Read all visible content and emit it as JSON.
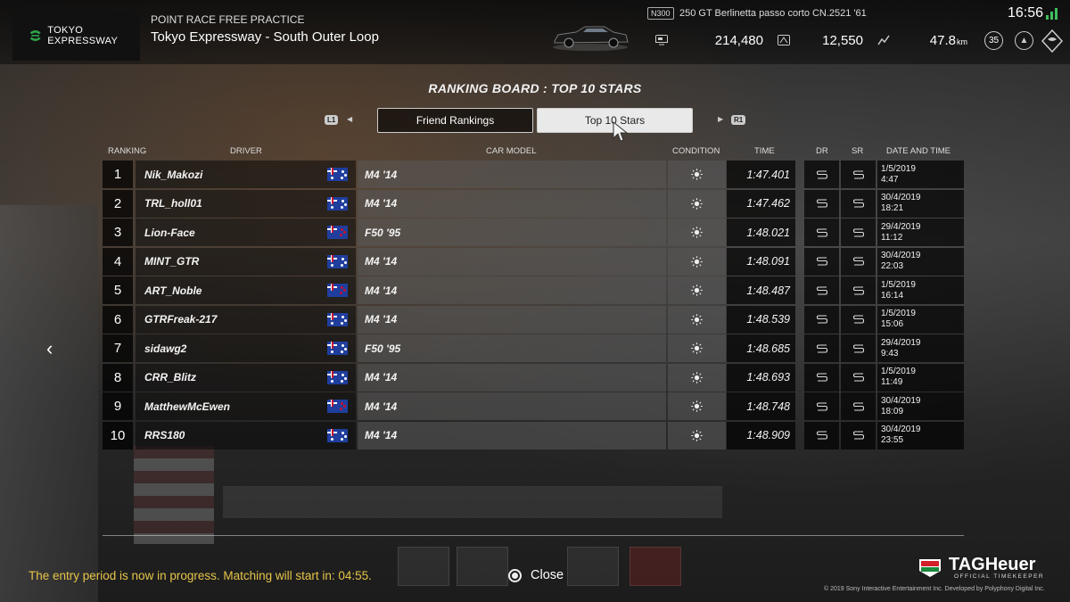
{
  "header": {
    "track_logo_text": "TOKYO EXPRESSWAY",
    "event_type": "POINT RACE FREE PRACTICE",
    "track_name": "Tokyo Expressway - South Outer Loop",
    "car_badge": "N300",
    "car_name": "250 GT Berlinetta passo corto CN.2521 '61",
    "credits": "214,480",
    "mileage_points": "12,550",
    "distance": "47.8",
    "distance_unit": "km",
    "clock": "16:56",
    "level": "35"
  },
  "board": {
    "title": "RANKING BOARD : TOP 10 STARS",
    "bumper_left": "L1",
    "bumper_right": "R1",
    "tabs": [
      {
        "label": "Friend Rankings",
        "active": false
      },
      {
        "label": "Top 10 Stars",
        "active": true
      }
    ],
    "columns": {
      "ranking": "RANKING",
      "driver": "DRIVER",
      "car_model": "CAR MODEL",
      "condition": "CONDITION",
      "time": "TIME",
      "dr": "DR",
      "sr": "SR",
      "date_time": "DATE AND TIME"
    },
    "rows": [
      {
        "rank": "1",
        "driver": "Nik_Makozi",
        "car": "M4 '14",
        "time": "1:47.401",
        "dr": "S",
        "sr": "S",
        "date": "1/5/2019",
        "clock": "4:47",
        "flag": "AU"
      },
      {
        "rank": "2",
        "driver": "TRL_holl01",
        "car": "M4 '14",
        "time": "1:47.462",
        "dr": "S",
        "sr": "S",
        "date": "30/4/2019",
        "clock": "18:21",
        "flag": "AU"
      },
      {
        "rank": "3",
        "driver": "Lion-Face",
        "car": "F50 '95",
        "time": "1:48.021",
        "dr": "S",
        "sr": "S",
        "date": "29/4/2019",
        "clock": "11:12",
        "flag": "NZ"
      },
      {
        "rank": "4",
        "driver": "MINT_GTR",
        "car": "M4 '14",
        "time": "1:48.091",
        "dr": "S",
        "sr": "S",
        "date": "30/4/2019",
        "clock": "22:03",
        "flag": "AU"
      },
      {
        "rank": "5",
        "driver": "ART_Noble",
        "car": "M4 '14",
        "time": "1:48.487",
        "dr": "S",
        "sr": "S",
        "date": "1/5/2019",
        "clock": "16:14",
        "flag": "NZ"
      },
      {
        "rank": "6",
        "driver": "GTRFreak-217",
        "car": "M4 '14",
        "time": "1:48.539",
        "dr": "S",
        "sr": "S",
        "date": "1/5/2019",
        "clock": "15:06",
        "flag": "AU"
      },
      {
        "rank": "7",
        "driver": "sidawg2",
        "car": "F50 '95",
        "time": "1:48.685",
        "dr": "S",
        "sr": "S",
        "date": "29/4/2019",
        "clock": "9:43",
        "flag": "AU"
      },
      {
        "rank": "8",
        "driver": "CRR_Blitz",
        "car": "M4 '14",
        "time": "1:48.693",
        "dr": "S",
        "sr": "S",
        "date": "1/5/2019",
        "clock": "11:49",
        "flag": "AU"
      },
      {
        "rank": "9",
        "driver": "MatthewMcEwen",
        "car": "M4 '14",
        "time": "1:48.748",
        "dr": "S",
        "sr": "S",
        "date": "30/4/2019",
        "clock": "18:09",
        "flag": "NZ"
      },
      {
        "rank": "10",
        "driver": "RRS180",
        "car": "M4 '14",
        "time": "1:48.909",
        "dr": "S",
        "sr": "S",
        "date": "30/4/2019",
        "clock": "23:55",
        "flag": "AU"
      }
    ]
  },
  "footer": {
    "entry_message": "The entry period is now in progress. Matching will start in: 04:55.",
    "close_label": "Close",
    "sponsor": "TAGHeuer",
    "sponsor_sub": "OFFICIAL TIMEKEEPER",
    "copyright": "© 2019 Sony Interactive Entertainment Inc. Developed by Polyphony Digital Inc."
  },
  "icons": {
    "condition": "sun-icon",
    "rating": "s-rating-icon",
    "back": "chevron-left-icon",
    "close": "circle-button-icon"
  },
  "colors": {
    "accent_yellow": "#e7c54a",
    "active_tab": "#e9e9e9",
    "logo_green": "#2fa34a"
  }
}
